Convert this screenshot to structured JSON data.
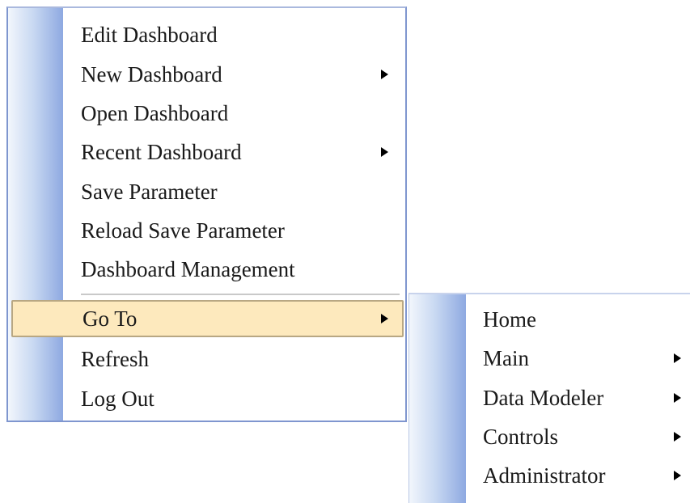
{
  "main_menu": {
    "items": [
      {
        "label": "Edit Dashboard",
        "submenu": false
      },
      {
        "label": "New Dashboard",
        "submenu": true
      },
      {
        "label": "Open Dashboard",
        "submenu": false
      },
      {
        "label": "Recent Dashboard",
        "submenu": true
      },
      {
        "label": "Save Parameter",
        "submenu": false
      },
      {
        "label": "Reload Save Parameter",
        "submenu": false
      },
      {
        "label": "Dashboard Management",
        "submenu": false
      },
      {
        "label": "Go To",
        "submenu": true,
        "highlighted": true
      },
      {
        "label": "Refresh",
        "submenu": false
      },
      {
        "label": "Log Out",
        "submenu": false
      }
    ]
  },
  "go_to_submenu": {
    "items": [
      {
        "label": "Home",
        "submenu": false
      },
      {
        "label": "Main",
        "submenu": true
      },
      {
        "label": "Data Modeler",
        "submenu": true
      },
      {
        "label": "Controls",
        "submenu": true
      },
      {
        "label": "Administrator",
        "submenu": true
      }
    ]
  },
  "colors": {
    "highlight_background": "#fde9bd",
    "highlight_border": "#b8a783",
    "menu_border": "#7f96cf",
    "gutter_gradient_end": "#8ea9e1"
  },
  "icons": {
    "submenu_indicator": "submenu-arrow-icon"
  }
}
